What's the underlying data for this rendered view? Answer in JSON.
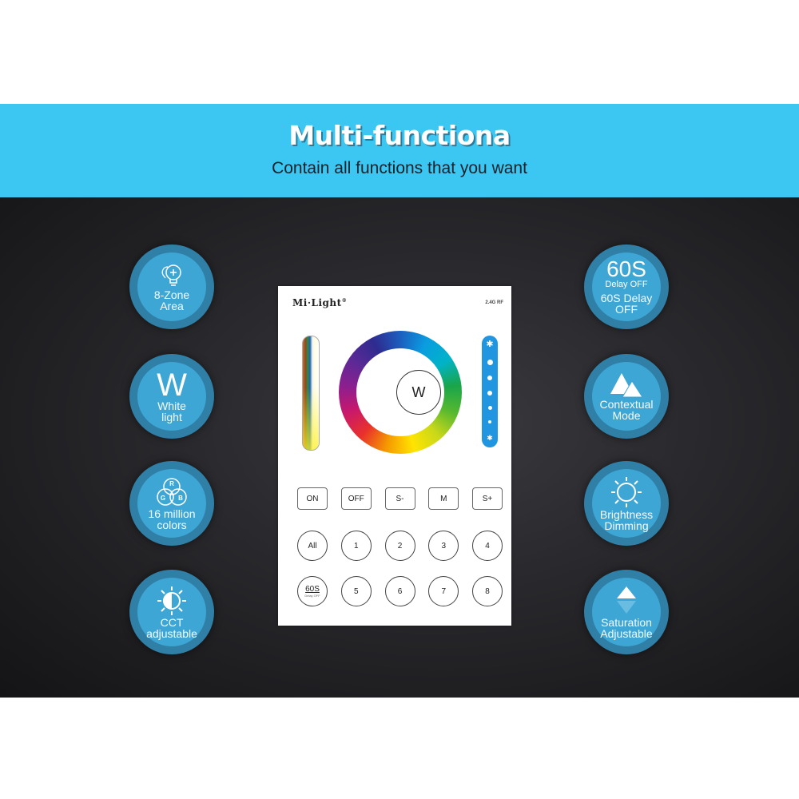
{
  "banner": {
    "title": "Multi-functiona",
    "subtitle": "Contain all functions that you want",
    "color": "#3cc6f2"
  },
  "features_left": [
    {
      "icon": "bulb-zone-icon",
      "label_line1": "8-Zone",
      "label_line2": "Area"
    },
    {
      "icon": "w-letter-icon",
      "big": "W",
      "label_line1": "White",
      "label_line2": "light"
    },
    {
      "icon": "rgb-circles-icon",
      "rgb": [
        "R",
        "G",
        "B"
      ],
      "label_line1": "16 million",
      "label_line2": "colors"
    },
    {
      "icon": "cct-sun-icon",
      "label_line1": "CCT",
      "label_line2": "adjustable"
    }
  ],
  "features_right": [
    {
      "icon": "timer-60s-icon",
      "big": "60S",
      "small": "Delay OFF",
      "label_line1": "60S Delay",
      "label_line2": "OFF"
    },
    {
      "icon": "mountains-icon",
      "label_line1": "Contextual",
      "label_line2": "Mode"
    },
    {
      "icon": "sun-icon",
      "label_line1": "Brightness",
      "label_line2": "Dimming"
    },
    {
      "icon": "saturation-triangle-icon",
      "label_line1": "Saturation",
      "label_line2": "Adjustable"
    }
  ],
  "remote": {
    "brand": "Mi·Light",
    "brand_mark": "®",
    "rf_label": "2.4G RF",
    "w_button": "W",
    "function_buttons": [
      "ON",
      "OFF",
      "S-",
      "M",
      "S+"
    ],
    "zone_row1": [
      "All",
      "1",
      "2",
      "3",
      "4"
    ],
    "delay_button": {
      "main": "60S",
      "sub": "Delay OFF"
    },
    "zone_row2": [
      "5",
      "6",
      "7",
      "8"
    ]
  }
}
